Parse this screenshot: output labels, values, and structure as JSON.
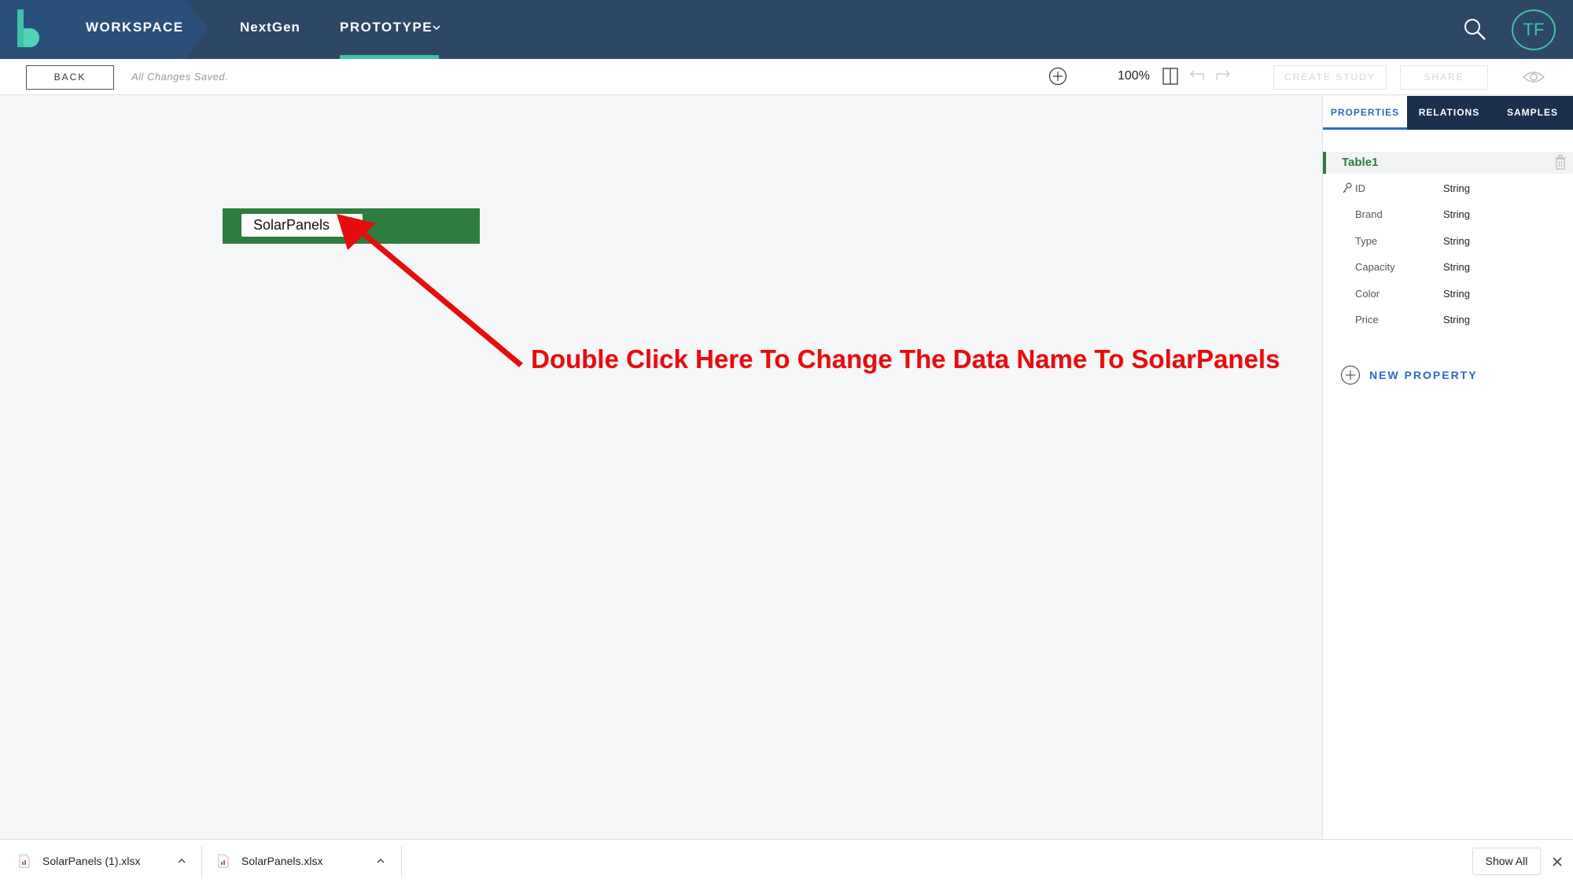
{
  "nav": {
    "workspace": "WORKSPACE",
    "project": "NextGen",
    "prototype": "PROTOTYPE",
    "avatar_initials": "TF"
  },
  "toolbar": {
    "back_label": "BACK",
    "save_status": "All Changes Saved.",
    "zoom": "100%",
    "create_study_label": "CREATE STUDY",
    "share_label": "SHARE"
  },
  "canvas": {
    "table_name": "SolarPanels",
    "annotation": "Double Click Here To Change The Data Name To SolarPanels"
  },
  "panel": {
    "tabs": [
      "PROPERTIES",
      "RELATIONS",
      "SAMPLES"
    ],
    "table_label": "Table1",
    "properties": [
      {
        "name": "ID",
        "type": "String"
      },
      {
        "name": "Brand",
        "type": "String"
      },
      {
        "name": "Type",
        "type": "String"
      },
      {
        "name": "Capacity",
        "type": "String"
      },
      {
        "name": "Color",
        "type": "String"
      },
      {
        "name": "Price",
        "type": "String"
      }
    ],
    "new_property_label": "NEW PROPERTY"
  },
  "downloads": {
    "files": [
      "SolarPanels (1).xlsx",
      "SolarPanels.xlsx"
    ],
    "show_all": "Show All"
  },
  "colors": {
    "nav_bg": "#2d4766",
    "accent_teal": "#3ec3a6",
    "table_green": "#2f7d3e",
    "link_blue": "#2d69c4",
    "annotation_red": "#e50d0d"
  }
}
